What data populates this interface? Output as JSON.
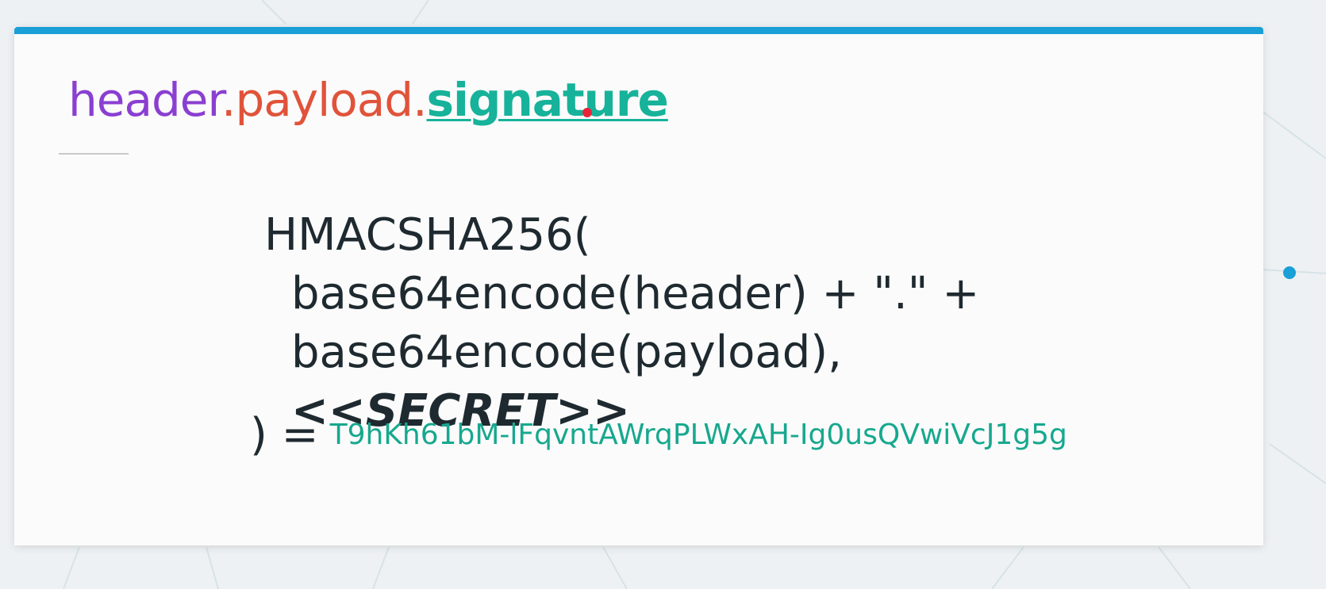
{
  "slide": {
    "title_header": "header",
    "title_dot1": ".",
    "title_payload": "payload",
    "title_dot2": ".",
    "title_signature": "signature",
    "formula": {
      "line1": "HMACSHA256(",
      "line2": "base64encode(header) + \".\" +",
      "line3": "base64encode(payload),",
      "secret_open": "<<",
      "secret_word": "SECRET",
      "secret_close": ">>",
      "result_prefix": ") =",
      "result_value": "T9hKh61bM-lFqvntAWrqPLWxAH-Ig0usQVwiVcJ1g5g"
    }
  },
  "colors": {
    "header": "#8a3fd1",
    "payload": "#e0533a",
    "signature": "#17b29a",
    "accent_bar": "#1a9fd6",
    "cursor": "#e8243b"
  }
}
